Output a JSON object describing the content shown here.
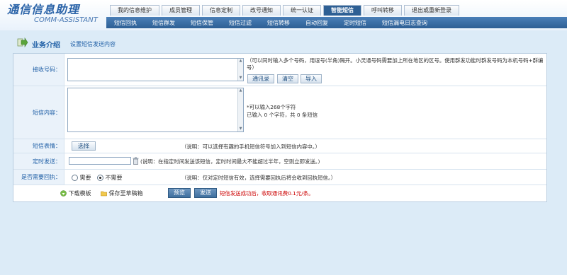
{
  "logo": {
    "cn": "通信信息助理",
    "en": "COMM-ASSISTANT"
  },
  "top_tabs": [
    "我的信息维护",
    "成员管理",
    "信息定制",
    "改号通知",
    "统一认证",
    "智能短信",
    "呼叫转移",
    "退出或重新登录"
  ],
  "top_tabs_active": "智能短信",
  "sub_nav": [
    "短信回执",
    "短信群发",
    "短信保管",
    "短信过滤",
    "短信转移",
    "自动回复",
    "定时短信",
    "短信漏电日志查询"
  ],
  "page": {
    "title": "业务介绍",
    "link": "设置短信发送内容"
  },
  "form": {
    "receiver": {
      "label": "接收号码：",
      "value": "",
      "hint": "（可以同时输入多个号码，用逗号(半角)隔开。小灵通号码需要加上所在地区的区号。使用群发功能时群发号码为本机号码+群编号）",
      "buttons": [
        "通讯录",
        "清空",
        "导入"
      ]
    },
    "content": {
      "label": "短信内容：",
      "value": "",
      "hint1": "*可以输入268个字符",
      "hint2": "已输入 0 个字符，共 0 条短信"
    },
    "emoticon": {
      "label": "短信表情：",
      "button": "选择",
      "note": "（说明：可以选择有趣的手机短信符号加入到短信内容中。）"
    },
    "schedule": {
      "label": "定时发送：",
      "value": "",
      "note": "(说明：在指定时间发送该短信，定时时间最大不能超过半年，空则立即发送。)"
    },
    "receipt": {
      "label": "是否需要回执：",
      "options": [
        "需要",
        "不需要"
      ],
      "selected": "不需要",
      "note": "（说明：仅对定时短信有效，选择需要回执后将会收到回执短信。）"
    }
  },
  "actions": {
    "download": "下载模板",
    "save_draft": "保存至草稿箱",
    "preview": "预览",
    "send": "发送",
    "fee_note": "短信发送成功后，收取通讯费0.1元/条。"
  },
  "colors": {
    "accent": "#2d5f94",
    "background": "#dcebf7",
    "warning": "#cc0000"
  }
}
